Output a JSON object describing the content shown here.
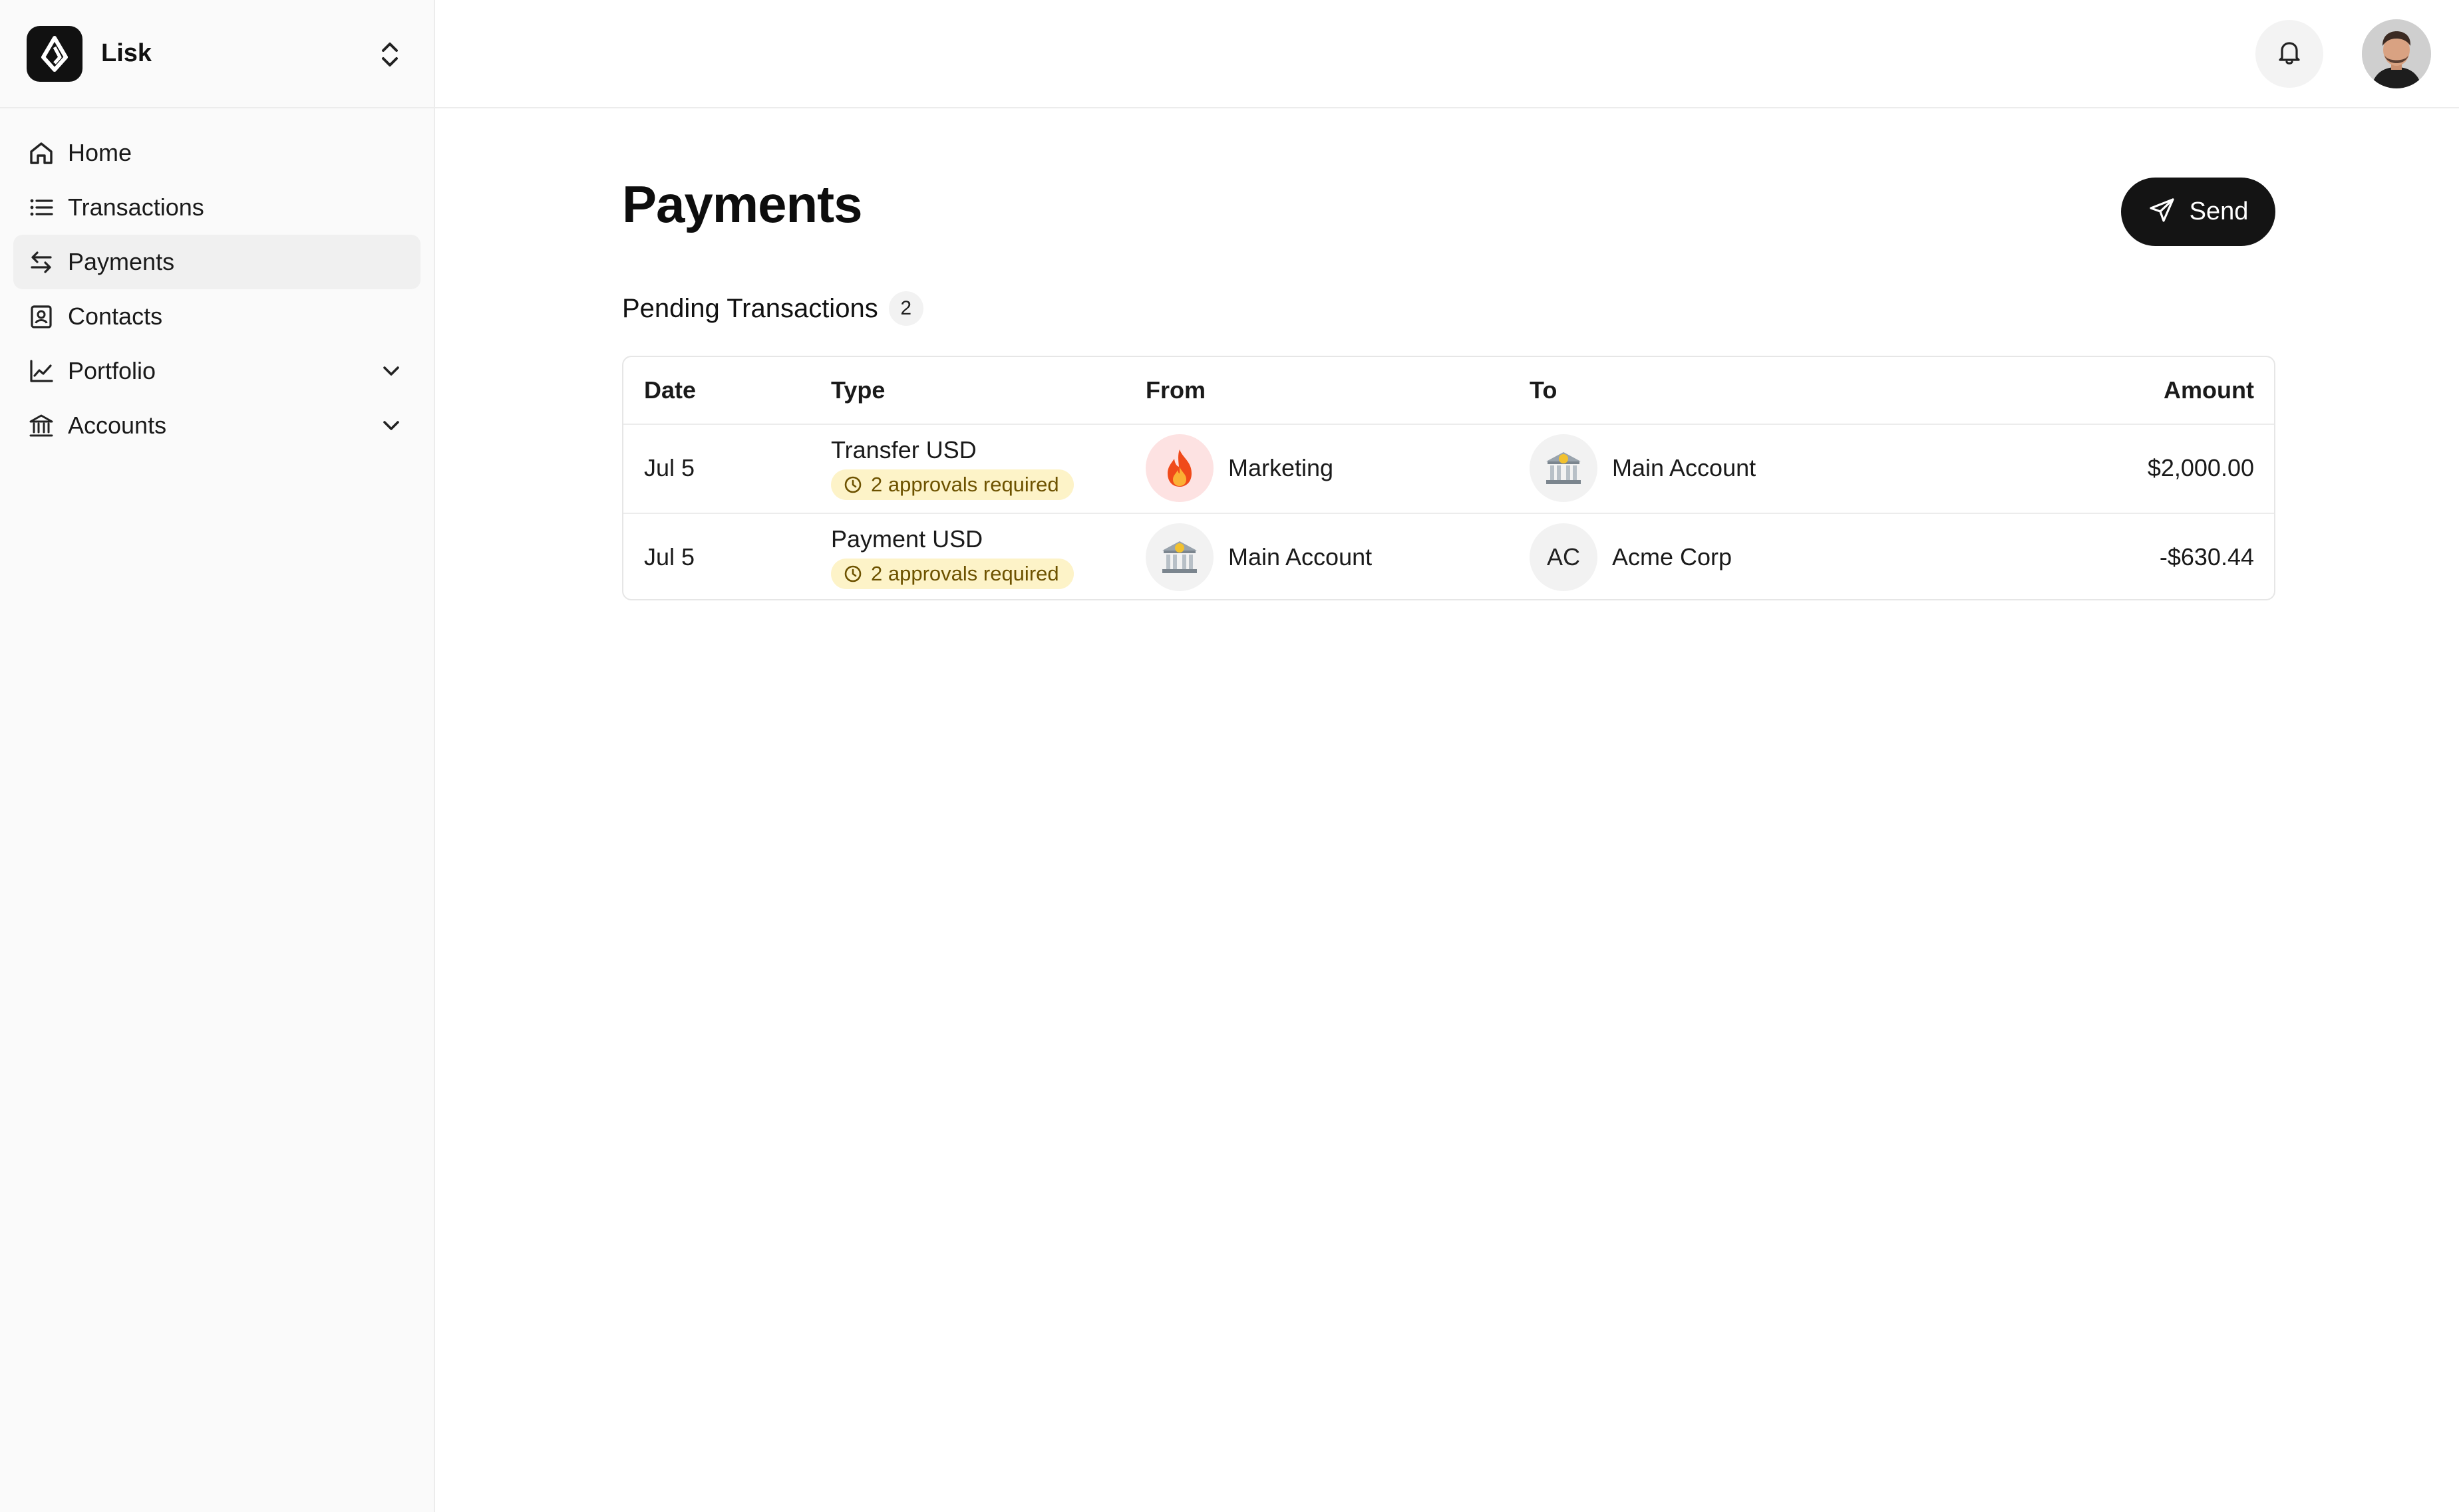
{
  "app": {
    "name": "Lisk"
  },
  "sidebar": {
    "items": [
      {
        "label": "Home",
        "icon": "home-icon"
      },
      {
        "label": "Transactions",
        "icon": "list-icon"
      },
      {
        "label": "Payments",
        "icon": "arrows-exchange-icon",
        "active": true
      },
      {
        "label": "Contacts",
        "icon": "contact-card-icon"
      },
      {
        "label": "Portfolio",
        "icon": "line-chart-icon",
        "expandable": true
      },
      {
        "label": "Accounts",
        "icon": "bank-icon",
        "expandable": true
      }
    ]
  },
  "header": {
    "notifications_icon": "bell-icon",
    "avatar_icon": "user-avatar"
  },
  "page": {
    "title": "Payments",
    "send_label": "Send"
  },
  "pending": {
    "title": "Pending Transactions",
    "count": "2"
  },
  "table": {
    "columns": {
      "date": "Date",
      "type": "Type",
      "from": "From",
      "to": "To",
      "amount": "Amount"
    },
    "rows": [
      {
        "date": "Jul 5",
        "type": "Transfer USD",
        "approval": "2 approvals required",
        "from": {
          "name": "Marketing",
          "icon": "fire-icon"
        },
        "to": {
          "name": "Main Account",
          "icon": "bank-building-icon"
        },
        "amount": "$2,000.00"
      },
      {
        "date": "Jul 5",
        "type": "Payment USD",
        "approval": "2 approvals required",
        "from": {
          "name": "Main Account",
          "icon": "bank-building-icon"
        },
        "to": {
          "name": "Acme Corp",
          "initials": "AC"
        },
        "amount": "-$630.44"
      }
    ]
  },
  "colors": {
    "accent_dark": "#141414",
    "sidebar_bg": "#fafafa",
    "active_item_bg": "#f0f0f0",
    "approval_bg": "#fdf3c8",
    "approval_text": "#6d5200",
    "fire_avatar_bg": "#fde2e2"
  }
}
